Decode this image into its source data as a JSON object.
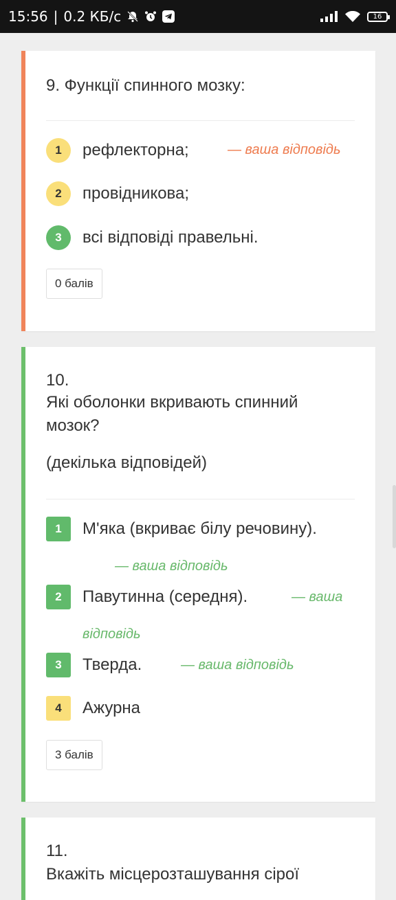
{
  "status_bar": {
    "time": "15:56",
    "net_speed": "0.2 КБ/с",
    "battery": "16",
    "icons": [
      "bell-off-icon",
      "alarm-icon",
      "telegram-icon",
      "signal-icon",
      "wifi-icon",
      "battery-icon"
    ]
  },
  "your_answer": "— ваша відповідь",
  "your_answer_part1": "— ваша",
  "your_answer_part2": "відповідь",
  "q9": {
    "title": "9. Функції спинного мозку:",
    "options": [
      {
        "num": "1",
        "text": "рефлекторна;",
        "state": "wrong"
      },
      {
        "num": "2",
        "text": "провідникова;",
        "state": "missed"
      },
      {
        "num": "3",
        "text": "всі відповіді правельні.",
        "state": "correct"
      }
    ],
    "score": "0 балів"
  },
  "q10": {
    "number": "10.",
    "title_line1": "Які оболонки вкривають спинний",
    "title_line2": "мозок?",
    "hint": "(декілька відповідей)",
    "options": [
      {
        "num": "1",
        "text": "М'яка (вкриває білу речовину).",
        "state": "correct"
      },
      {
        "num": "2",
        "text": "Павутинна (середня).",
        "state": "correct"
      },
      {
        "num": "3",
        "text": "Тверда.",
        "state": "correct"
      },
      {
        "num": "4",
        "text": "Ажурна",
        "state": "neutral"
      }
    ],
    "score": "3 балів"
  },
  "q11": {
    "number": "11.",
    "title_line1": "Вкажіть місцерозташування сірої"
  },
  "colors": {
    "orange_accent": "#f0845a",
    "green_accent": "#6cbf6b",
    "yellow_badge": "#fadf7a",
    "green_badge": "#61ba6b"
  }
}
